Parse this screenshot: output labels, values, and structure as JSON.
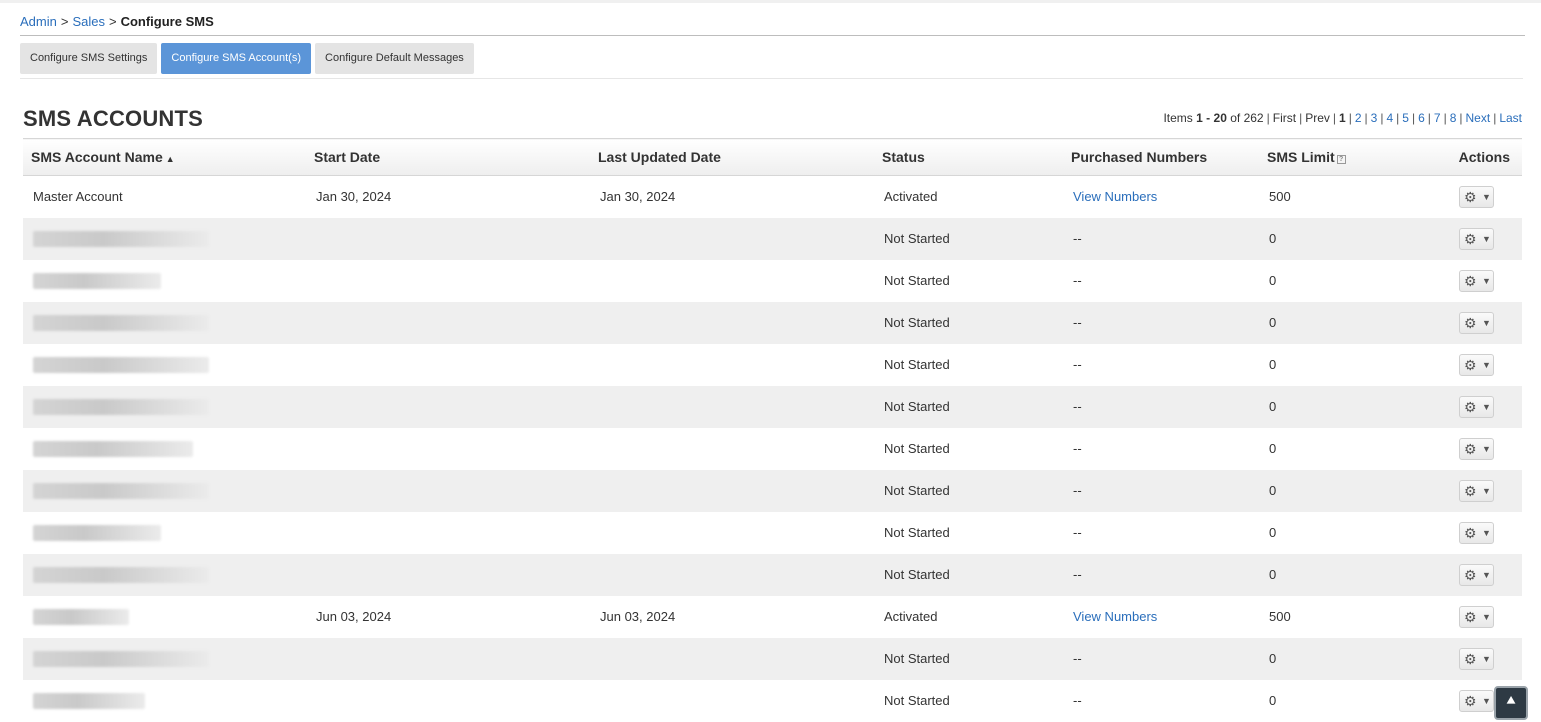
{
  "breadcrumb": {
    "items": [
      "Admin",
      "Sales"
    ],
    "separator": ">",
    "current": "Configure SMS"
  },
  "tabs": [
    {
      "label": "Configure SMS Settings",
      "active": false
    },
    {
      "label": "Configure SMS Account(s)",
      "active": true
    },
    {
      "label": "Configure Default Messages",
      "active": false
    }
  ],
  "section_title": "SMS ACCOUNTS",
  "pager": {
    "items_label": "Items",
    "range_start": "1",
    "range_sep": "-",
    "range_end": "20",
    "of_label": "of",
    "total": "262",
    "first": "First",
    "prev": "Prev",
    "current_page": "1",
    "pages": [
      "2",
      "3",
      "4",
      "5",
      "6",
      "7",
      "8"
    ],
    "next": "Next",
    "last": "Last"
  },
  "table": {
    "columns": {
      "name": "SMS Account Name",
      "start": "Start Date",
      "updated": "Last Updated Date",
      "status": "Status",
      "numbers": "Purchased Numbers",
      "limit": "SMS Limit",
      "actions": "Actions"
    },
    "sort_indicator": "▲",
    "help_icon": "?",
    "rows": [
      {
        "name": "Master Account",
        "start": "Jan 30, 2024",
        "updated": "Jan 30, 2024",
        "status": "Activated",
        "numbers": "View Numbers",
        "limit": "500"
      },
      {
        "name": "",
        "start": "",
        "updated": "",
        "status": "Not Started",
        "numbers": "--",
        "limit": "0"
      },
      {
        "name": "",
        "start": "",
        "updated": "",
        "status": "Not Started",
        "numbers": "--",
        "limit": "0"
      },
      {
        "name": "",
        "start": "",
        "updated": "",
        "status": "Not Started",
        "numbers": "--",
        "limit": "0"
      },
      {
        "name": "",
        "start": "",
        "updated": "",
        "status": "Not Started",
        "numbers": "--",
        "limit": "0"
      },
      {
        "name": "",
        "start": "",
        "updated": "",
        "status": "Not Started",
        "numbers": "--",
        "limit": "0"
      },
      {
        "name": "",
        "start": "",
        "updated": "",
        "status": "Not Started",
        "numbers": "--",
        "limit": "0"
      },
      {
        "name": "",
        "start": "",
        "updated": "",
        "status": "Not Started",
        "numbers": "--",
        "limit": "0"
      },
      {
        "name": "",
        "start": "",
        "updated": "",
        "status": "Not Started",
        "numbers": "--",
        "limit": "0"
      },
      {
        "name": "",
        "start": "",
        "updated": "",
        "status": "Not Started",
        "numbers": "--",
        "limit": "0"
      },
      {
        "name": "",
        "start": "Jun 03, 2024",
        "updated": "Jun 03, 2024",
        "status": "Activated",
        "numbers": "View Numbers",
        "limit": "500"
      },
      {
        "name": "",
        "start": "",
        "updated": "",
        "status": "Not Started",
        "numbers": "--",
        "limit": "0"
      },
      {
        "name": "",
        "start": "",
        "updated": "",
        "status": "Not Started",
        "numbers": "--",
        "limit": "0"
      }
    ]
  },
  "icons": {
    "gear": "gear-icon",
    "caret": "caret-down-icon",
    "scroll_top": "double-chevron-up-icon"
  },
  "colors": {
    "link": "#2a6ebb",
    "active_tab": "#5b95d8",
    "zebra_row": "#efefef"
  }
}
